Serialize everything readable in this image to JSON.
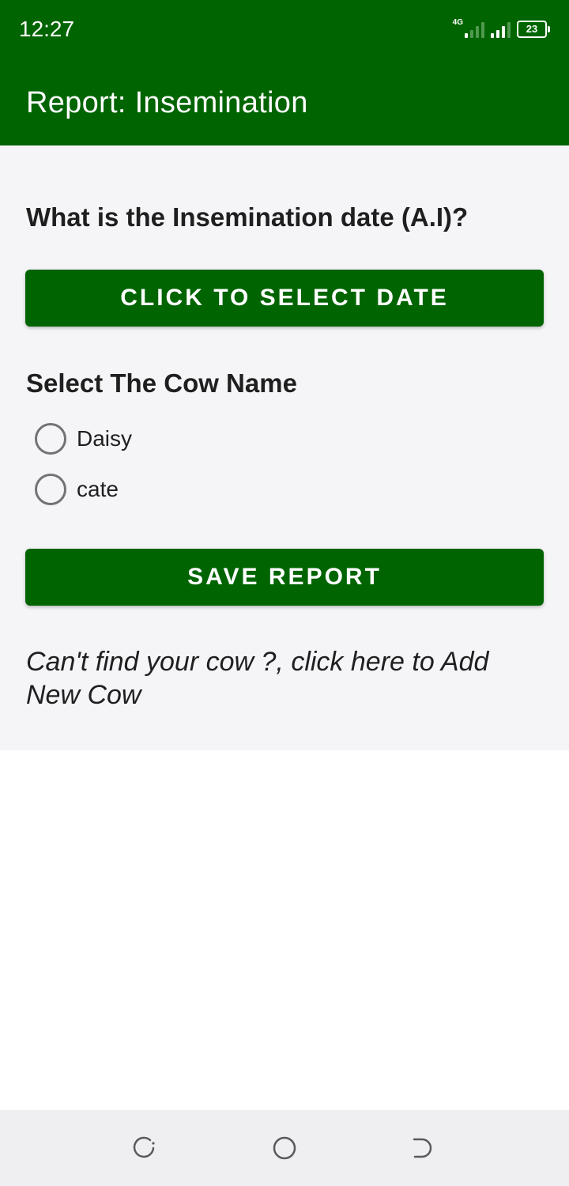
{
  "status_bar": {
    "time": "12:27",
    "network_label": "4G",
    "battery_level": "23",
    "icons": [
      "signal-4g-icon",
      "signal-icon",
      "battery-icon"
    ]
  },
  "app_bar": {
    "title": "Report: Insemination"
  },
  "form": {
    "date_question": "What is the Insemination date (A.I)?",
    "select_date_button": "CLICK TO SELECT DATE",
    "cow_section_title": "Select The Cow Name",
    "cows": [
      {
        "name": "Daisy",
        "selected": false
      },
      {
        "name": "cate",
        "selected": false
      }
    ],
    "save_button": "SAVE REPORT",
    "add_cow_link": "Can't find your cow ?, click here to Add New Cow"
  },
  "nav_bar": {
    "icons": [
      "recent-apps-icon",
      "home-icon",
      "back-icon"
    ]
  },
  "colors": {
    "primary": "#006400",
    "content_background": "#f5f4f7",
    "text": "#1f1f1f"
  }
}
